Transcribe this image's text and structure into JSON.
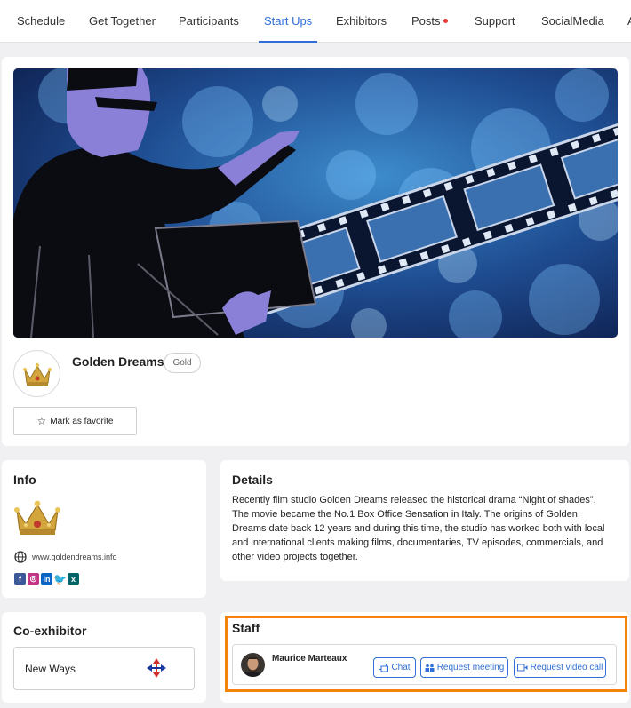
{
  "nav": {
    "tabs": [
      {
        "label": "Schedule"
      },
      {
        "label": "Get Together"
      },
      {
        "label": "Participants"
      },
      {
        "label": "Start Ups"
      },
      {
        "label": "Exhibitors"
      },
      {
        "label": "Posts"
      },
      {
        "label": "Support"
      },
      {
        "label": "SocialMedia"
      },
      {
        "label": "A"
      }
    ],
    "active": "Start Ups",
    "notification_on": "Posts"
  },
  "exhibitor": {
    "name": "Golden Dreams",
    "tier": "Gold",
    "favorite_label": "Mark as favorite"
  },
  "info": {
    "title": "Info",
    "website": "www.goldendreams.info",
    "social_icons": [
      "facebook-icon",
      "instagram-icon",
      "linkedin-icon",
      "twitter-icon",
      "xing-icon"
    ]
  },
  "details": {
    "title": "Details",
    "text": "Recently film studio Golden Dreams released the historical drama “Night of shades”. The movie became the No.1 Box Office Sensation in Italy. The origins of Golden Dreams date back 12 years and during this time, the studio has worked both with local and international clients making films, documentaries, TV episodes, commercials, and other video projects together."
  },
  "coexhibitor": {
    "title": "Co-exhibitor",
    "name": "New Ways"
  },
  "staff": {
    "title": "Staff",
    "members": [
      {
        "name": "Maurice Marteaux",
        "chat_label": "Chat",
        "meeting_label": "Request meeting",
        "video_label": "Request video call"
      }
    ]
  },
  "colors": {
    "accent": "#2f6fd6",
    "highlight": "#f5840c",
    "notification": "#e53935",
    "banner_silhouette": "#8a80d8"
  }
}
